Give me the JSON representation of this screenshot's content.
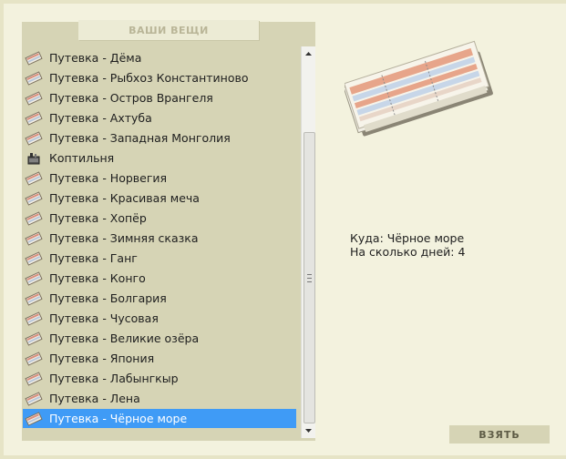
{
  "panel": {
    "title": "ВАШИ ВЕЩИ"
  },
  "items": [
    {
      "label": "Путевка - Дёма",
      "icon": "ticket-icon"
    },
    {
      "label": "Путевка - Рыбхоз Константиново",
      "icon": "ticket-icon"
    },
    {
      "label": "Путевка - Остров Врангеля",
      "icon": "ticket-icon"
    },
    {
      "label": "Путевка - Ахтуба",
      "icon": "ticket-icon"
    },
    {
      "label": "Путевка - Западная Монголия",
      "icon": "ticket-icon"
    },
    {
      "label": "Коптильня",
      "icon": "smokehouse-icon"
    },
    {
      "label": "Путевка - Норвегия",
      "icon": "ticket-icon"
    },
    {
      "label": "Путевка - Красивая меча",
      "icon": "ticket-icon"
    },
    {
      "label": "Путевка - Хопёр",
      "icon": "ticket-icon"
    },
    {
      "label": "Путевка - Зимняя сказка",
      "icon": "ticket-icon"
    },
    {
      "label": "Путевка - Ганг",
      "icon": "ticket-icon"
    },
    {
      "label": "Путевка - Конго",
      "icon": "ticket-icon"
    },
    {
      "label": "Путевка - Болгария",
      "icon": "ticket-icon"
    },
    {
      "label": "Путевка - Чусовая",
      "icon": "ticket-icon"
    },
    {
      "label": "Путевка - Великие озёра",
      "icon": "ticket-icon"
    },
    {
      "label": "Путевка - Япония",
      "icon": "ticket-icon"
    },
    {
      "label": "Путевка - Лабынгкыр",
      "icon": "ticket-icon"
    },
    {
      "label": "Путевка - Лена",
      "icon": "ticket-icon"
    },
    {
      "label": "Путевка - Чёрное море",
      "icon": "ticket-icon",
      "selected": true
    }
  ],
  "details": {
    "destination_line": "Куда: Чёрное море",
    "days_line": "На сколько дней: 4"
  },
  "actions": {
    "take_label": "ВЗЯТЬ"
  },
  "colors": {
    "background": "#f3f2de",
    "panel": "#d6d4b5",
    "selection": "#3f9bf6"
  }
}
